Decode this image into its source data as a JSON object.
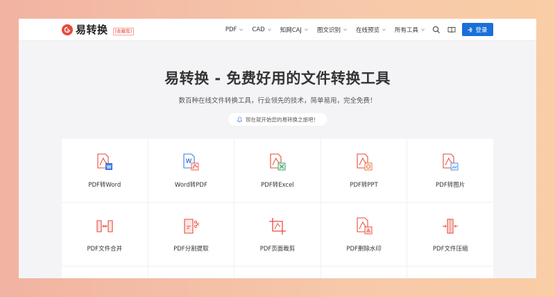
{
  "brand": {
    "name": "易转换",
    "tag": "[收藏我]"
  },
  "nav": {
    "items": [
      "PDF",
      "CAD",
      "知网CAJ",
      "图文识别",
      "在线预览",
      "所有工具"
    ],
    "login_label": "登录"
  },
  "hero": {
    "title": "易转换 - 免费好用的文件转换工具",
    "subtitle": "数百种在线文件转换工具，行业领先的技术，简单易用，完全免费！",
    "pill": "现在就开始您的易转换之旅吧！"
  },
  "tools": [
    {
      "label": "PDF转Word",
      "icon": "pdf-to-word-icon"
    },
    {
      "label": "Word转PDF",
      "icon": "word-to-pdf-icon"
    },
    {
      "label": "PDF转Excel",
      "icon": "pdf-to-excel-icon"
    },
    {
      "label": "PDF转PPT",
      "icon": "pdf-to-ppt-icon"
    },
    {
      "label": "PDF转图片",
      "icon": "pdf-to-image-icon"
    },
    {
      "label": "PDF文件合并",
      "icon": "pdf-merge-icon"
    },
    {
      "label": "PDF分割提取",
      "icon": "pdf-split-icon"
    },
    {
      "label": "PDF页面裁剪",
      "icon": "pdf-crop-icon"
    },
    {
      "label": "PDF删除水印",
      "icon": "pdf-remove-watermark-icon"
    },
    {
      "label": "PDF文件压缩",
      "icon": "pdf-compress-icon"
    }
  ],
  "colors": {
    "accent": "#e64a3b",
    "primary": "#1a6fd9",
    "word": "#3b7de0",
    "excel": "#2e9e57",
    "ppt": "#e8743b",
    "image": "#4a90e2"
  }
}
